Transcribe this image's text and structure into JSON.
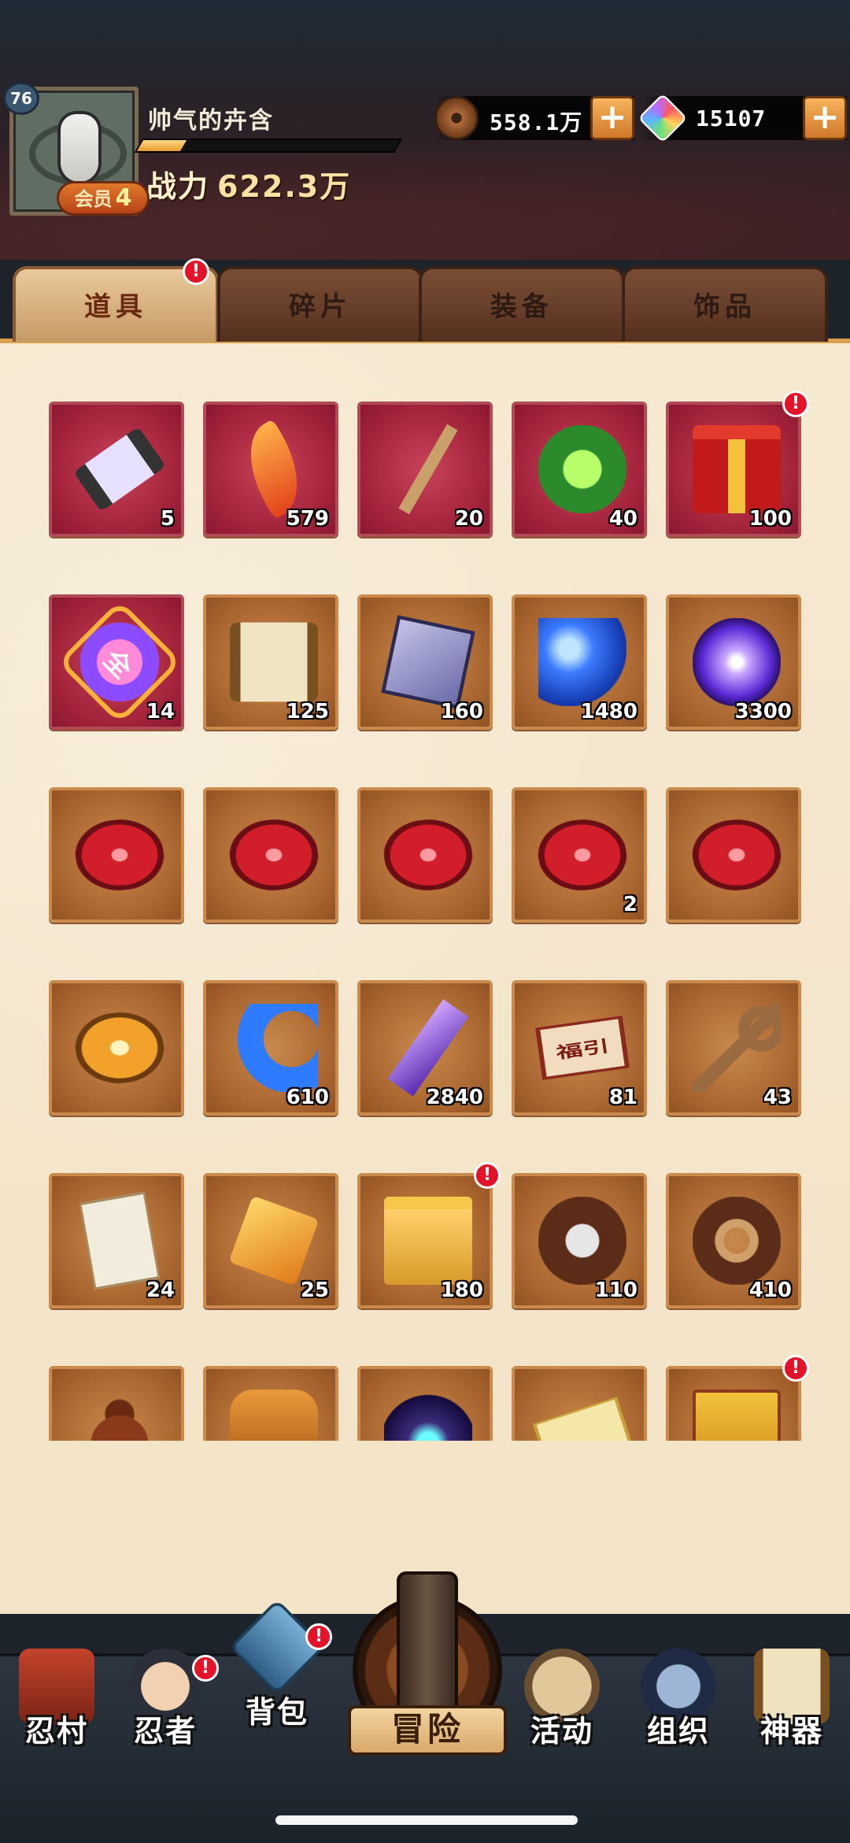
{
  "player": {
    "level": "76",
    "name": "帅气的卉含",
    "vip_label": "会员",
    "vip_level": "4",
    "exp_progress": 0.17,
    "power_label": "战力",
    "power_value": "622.3万"
  },
  "currencies": {
    "coin": {
      "icon": "copper-coin-icon",
      "value": "558.1万",
      "plus": "+"
    },
    "gem": {
      "icon": "rainbow-gem-icon",
      "value": "15107",
      "plus": "+"
    }
  },
  "tabs": [
    {
      "label": "道具",
      "active": true,
      "alert": "!"
    },
    {
      "label": "碎片",
      "active": false
    },
    {
      "label": "装备",
      "active": false
    },
    {
      "label": "饰品",
      "active": false
    }
  ],
  "items": [
    {
      "icon": "scroll-icon",
      "frame": "red",
      "count": "5"
    },
    {
      "icon": "feather-icon",
      "frame": "red",
      "count": "579"
    },
    {
      "icon": "stick-icon",
      "frame": "red",
      "count": "20"
    },
    {
      "icon": "jade-pendant-icon",
      "frame": "red",
      "count": "40"
    },
    {
      "icon": "gift-box-icon",
      "frame": "red",
      "count": "100",
      "alert": "!"
    },
    {
      "icon": "all-crystal-icon",
      "frame": "red",
      "count": "14",
      "glyph": "全"
    },
    {
      "icon": "map-scroll-icon",
      "frame": "brown",
      "count": "125"
    },
    {
      "icon": "cloth-icon",
      "frame": "brown",
      "count": "160"
    },
    {
      "icon": "blue-orb-icon",
      "frame": "brown",
      "count": "1480"
    },
    {
      "icon": "purple-orb-icon",
      "frame": "brown",
      "count": "3300"
    },
    {
      "icon": "red-stone-icon",
      "frame": "brown",
      "count": ""
    },
    {
      "icon": "red-stone-icon",
      "frame": "brown",
      "count": ""
    },
    {
      "icon": "red-stone-icon",
      "frame": "brown",
      "count": ""
    },
    {
      "icon": "red-stone-target-icon",
      "frame": "brown",
      "count": "2"
    },
    {
      "icon": "red-stone-eye-icon",
      "frame": "brown",
      "count": ""
    },
    {
      "icon": "gold-stone-icon",
      "frame": "brown",
      "count": ""
    },
    {
      "icon": "blue-moon-icon",
      "frame": "brown",
      "count": "610"
    },
    {
      "icon": "purple-crystal-icon",
      "frame": "brown",
      "count": "2840"
    },
    {
      "icon": "fuyin-talisman-icon",
      "frame": "brown",
      "count": "81",
      "glyph": "福引"
    },
    {
      "icon": "key-icon",
      "frame": "brown",
      "count": "43"
    },
    {
      "icon": "seal-paper-icon",
      "frame": "brown",
      "count": "24"
    },
    {
      "icon": "amber-cube-icon",
      "frame": "brown",
      "count": "25"
    },
    {
      "icon": "treasure-box-icon",
      "frame": "brown",
      "count": "180",
      "alert": "!"
    },
    {
      "icon": "silver-swirl-icon",
      "frame": "brown",
      "count": "110"
    },
    {
      "icon": "rope-swirl-icon",
      "frame": "brown",
      "count": "410"
    },
    {
      "icon": "gourd-icon",
      "frame": "brown",
      "count": ""
    },
    {
      "icon": "jar-icon",
      "frame": "brown",
      "count": ""
    },
    {
      "icon": "dark-orb-icon",
      "frame": "brown",
      "count": ""
    },
    {
      "icon": "ticket-icon",
      "frame": "brown",
      "count": ""
    },
    {
      "icon": "gift-crate-icon",
      "frame": "brown",
      "count": "",
      "alert": "!"
    }
  ],
  "nav": [
    {
      "label": "忍村",
      "icon": "village-gate-icon"
    },
    {
      "label": "忍者",
      "icon": "ninja-head-icon",
      "alert": "!"
    },
    {
      "label": "背包",
      "icon": "backpack-icon",
      "alert": "!",
      "active": true
    },
    {
      "label": "冒险",
      "icon": "adventure-scroll-icon"
    },
    {
      "label": "活动",
      "icon": "activity-drum-icon"
    },
    {
      "label": "组织",
      "icon": "organization-ninja-icon"
    },
    {
      "label": "神器",
      "icon": "artifact-scroll-icon"
    }
  ]
}
